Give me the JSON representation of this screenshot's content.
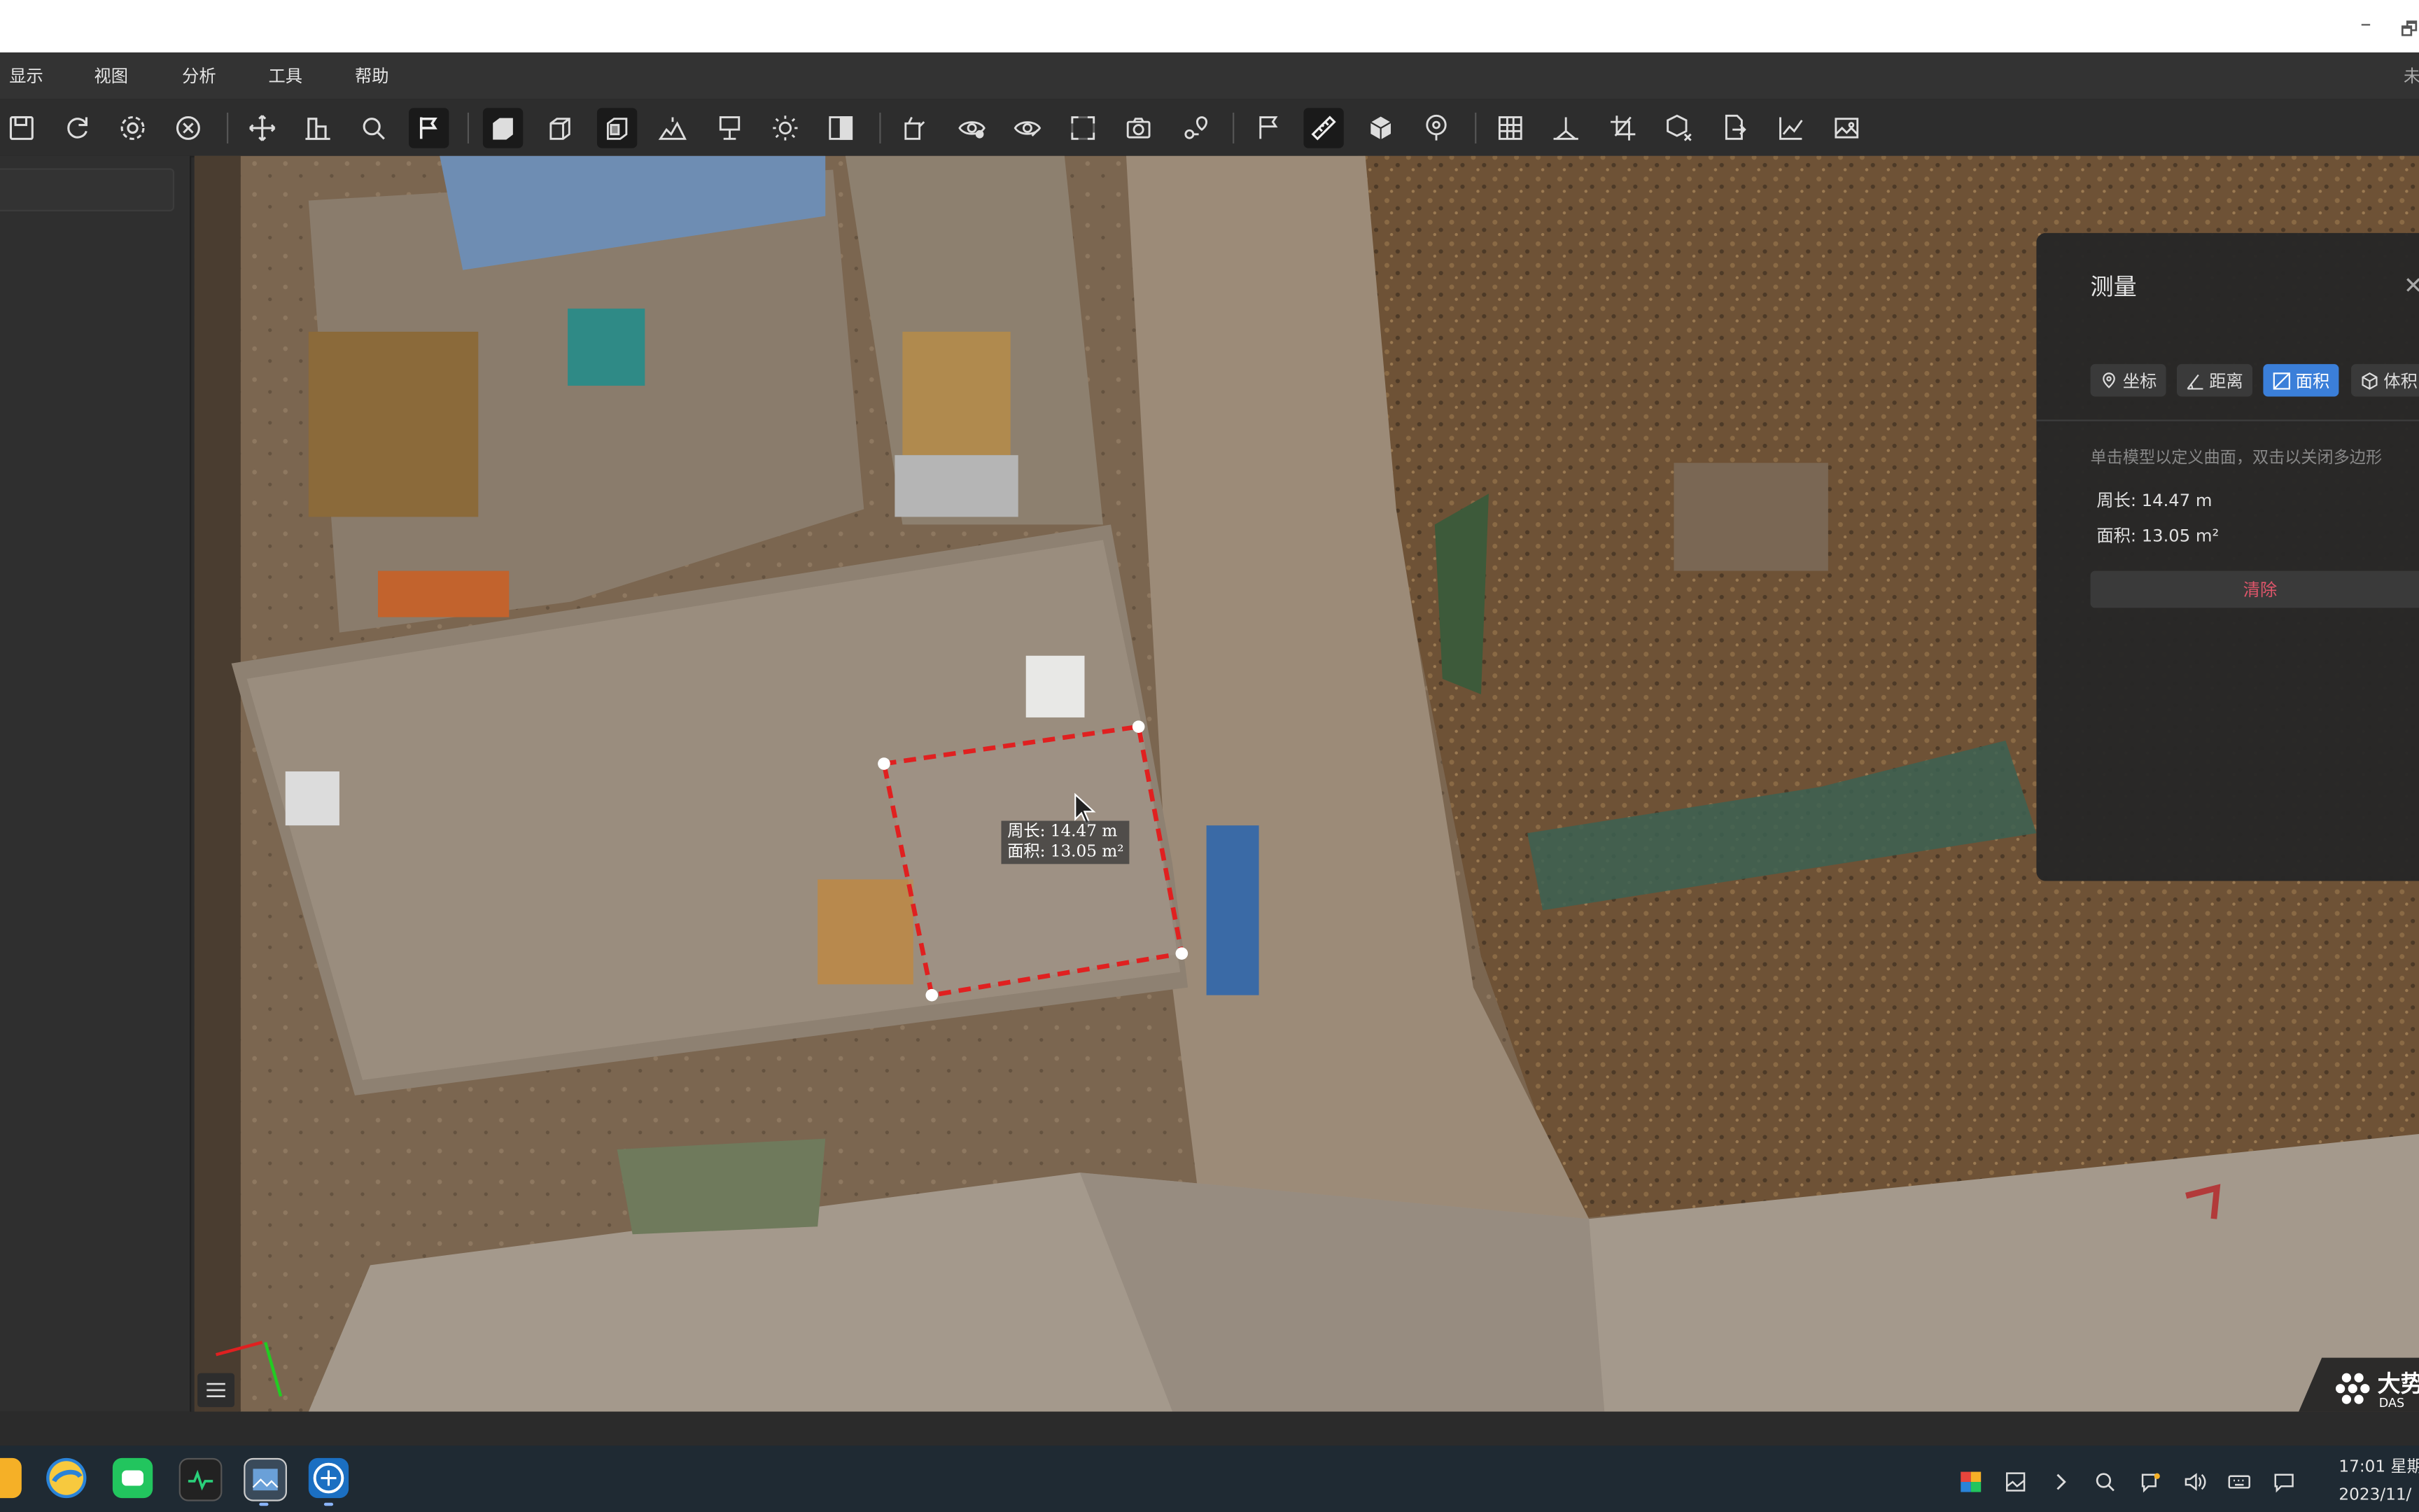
{
  "window": {
    "minimize": "–",
    "restore": "🗗",
    "right_edge_text": "未"
  },
  "menu": [
    "显示",
    "视图",
    "分析",
    "工具",
    "帮助"
  ],
  "toolbar_icons": [
    "save-icon",
    "refresh-icon",
    "settings-icon",
    "close-circle-icon",
    "move-icon",
    "elevation-icon",
    "search-icon",
    "flag-select-icon",
    "solid-view-icon",
    "wireframe-view-icon",
    "textured-view-icon",
    "terrain-icon",
    "sign-icon",
    "sun-icon",
    "contrast-icon",
    "paint-icon",
    "eye-icon",
    "hide-icon",
    "fullscreen-icon",
    "camera-icon",
    "route-icon",
    "flag-icon",
    "ruler-icon",
    "box-icon",
    "location-icon",
    "grid-icon",
    "section-icon",
    "crop-icon",
    "box-cut-icon",
    "export-icon",
    "chart-icon",
    "image-icon"
  ],
  "measure_panel": {
    "title": "测量",
    "close": "✕",
    "tabs": [
      {
        "label": "坐标",
        "icon": "location-pin-icon"
      },
      {
        "label": "距离",
        "icon": "angle-icon"
      },
      {
        "label": "面积",
        "icon": "area-icon",
        "active": true
      },
      {
        "label": "体积",
        "icon": "cube-icon"
      }
    ],
    "hint": "单击模型以定义曲面，双击以关闭多边形",
    "perimeter": "周长: 14.47 m",
    "area": "面积: 13.05 m²",
    "clear_label": "清除"
  },
  "overlay_label": {
    "line1": "周长: 14.47 m",
    "line2": "面积: 13.05 m²"
  },
  "watermark": {
    "brand": "大势",
    "sub": "DAS"
  },
  "colors": {
    "accent": "#3b7fd9",
    "measure_line": "#e02020",
    "clear_text": "#e0566b"
  },
  "taskbar": {
    "time": "17:01 星期",
    "date": "2023/11/"
  }
}
